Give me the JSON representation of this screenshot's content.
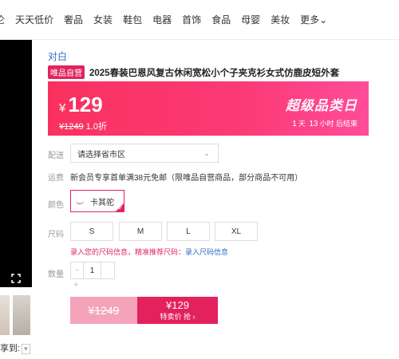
{
  "nav": {
    "items": [
      "伦",
      "天天低价",
      "奢品",
      "女装",
      "鞋包",
      "电器",
      "首饰",
      "食品",
      "母婴",
      "美妆"
    ],
    "more": "更多⌄"
  },
  "product": {
    "brand": "对白",
    "badge": "唯品自营",
    "title": "2025春装巴恩风复古休闲宽松小个子夹克衫女式仿鹿皮短外套"
  },
  "price_banner": {
    "currency": "¥",
    "price": "129",
    "original_price": "¥1249",
    "discount": "1.0折",
    "promo_title": "超级品类日",
    "countdown": {
      "days": "1",
      "day_unit": "天",
      "hours": "13",
      "hour_unit": "小时",
      "suffix": "后结束"
    }
  },
  "delivery": {
    "label": "配送",
    "placeholder": "请选择省市区",
    "caret": "⌄"
  },
  "shipping": {
    "label": "运费",
    "text": "新会员专享首单满38元免邮（限唯品自营商品，部分商品不可用）"
  },
  "color": {
    "label": "颜色",
    "selected": "卡其驼"
  },
  "size": {
    "label": "尺码",
    "options": [
      "S",
      "M",
      "L",
      "XL"
    ],
    "hint_prefix": "录入您的尺码信息，精准推荐尺码：",
    "hint_link": "录入尺码信息"
  },
  "quantity": {
    "label": "数量",
    "minus": "−",
    "value": "1",
    "plus": "+"
  },
  "buy": {
    "original": "¥1249",
    "price": "¥129",
    "label": "特卖价 抢 ›"
  },
  "share": {
    "label": "享到:",
    "caret": "▾"
  },
  "thumb_arrow": "›",
  "colors": {
    "accent": "#e0245e",
    "banner": "#f9315f",
    "link": "#2f6dc0"
  }
}
